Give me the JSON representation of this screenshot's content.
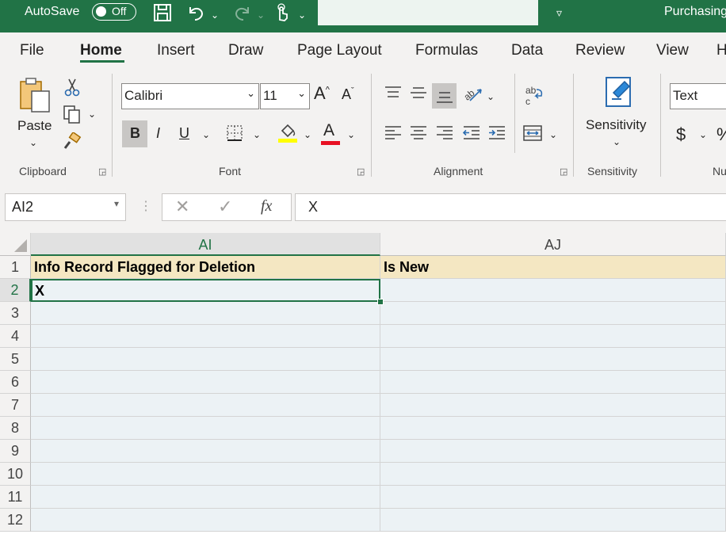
{
  "titlebar": {
    "autosave_label": "AutoSave",
    "autosave_state": "Off",
    "doc_title": "Purchasing"
  },
  "tabs": [
    "File",
    "Home",
    "Insert",
    "Draw",
    "Page Layout",
    "Formulas",
    "Data",
    "Review",
    "View",
    "H"
  ],
  "active_tab": "Home",
  "ribbon": {
    "clipboard": {
      "paste_label": "Paste",
      "group_label": "Clipboard"
    },
    "font": {
      "font_name": "Calibri",
      "font_size": "11",
      "group_label": "Font",
      "bold": "B",
      "italic": "I",
      "underline": "U",
      "grow": "A",
      "shrink": "A",
      "font_color_glyph": "A",
      "highlight_color": "#ffff00",
      "font_color": "#e81123"
    },
    "alignment": {
      "group_label": "Alignment"
    },
    "sensitivity": {
      "label": "Sensitivity",
      "group_label": "Sensitivity"
    },
    "number": {
      "format": "Text",
      "currency": "$",
      "percent": "%",
      "group_label": "Nu"
    }
  },
  "formula_bar": {
    "name_box": "AI2",
    "fx": "fx",
    "formula": "X"
  },
  "grid": {
    "columns": [
      "AI",
      "AJ"
    ],
    "selected_column": "AI",
    "rows": [
      "1",
      "2",
      "3",
      "4",
      "5",
      "6",
      "7",
      "8",
      "9",
      "10",
      "11",
      "12"
    ],
    "selected_row": "2",
    "cells": {
      "AI1": "Info Record Flagged for Deletion",
      "AJ1": "Is New",
      "AI2": "X"
    }
  },
  "colors": {
    "brand": "#217346",
    "header_fill": "#f4e7c2",
    "row_fill": "#ecf2f5"
  }
}
